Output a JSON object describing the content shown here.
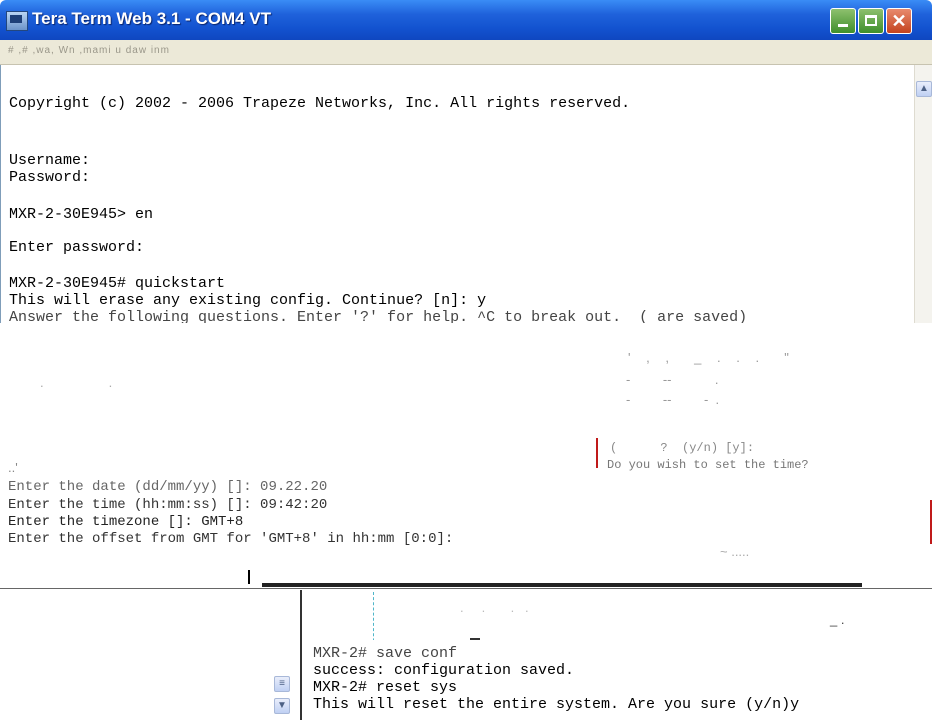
{
  "window": {
    "title": "Tera Term Web 3.1 - COM4 VT",
    "menu_text": "#  ,#  ,wa,  Wn   ,mami u daw inm"
  },
  "terminal": {
    "lines": [
      "Copyright (c) 2002 - 2006 Trapeze Networks, Inc. All rights reserved.",
      "",
      "",
      "Username:",
      "Password:",
      "",
      "MXR-2-30E945> en",
      "",
      "Enter password:",
      "",
      "MXR-2-30E945# quickstart",
      "This will erase any existing config. Continue? [n]: y",
      "Answer the following questions. Enter '?' for help. ^C to break out.  ( are saved)"
    ]
  },
  "middle": {
    "lines": [
      "Enter the date (dd/mm/yy) []: 09.22.20",
      "Enter the time (hh:mm:ss) []: 09:42:20",
      "Enter the timezone []: GMT+8",
      "Enter the offset from GMT for 'GMT+8' in hh:mm [0:0]:"
    ],
    "right_fragment": "Do you wish to set the time?",
    "right_fragment_top": "(      ?  (y/n) [y]:"
  },
  "bottom": {
    "lines": [
      "MXR-2# save conf",
      "success: configuration saved.",
      "MXR-2# reset sys",
      "This will reset the entire system. Are you sure (y/n)y"
    ]
  }
}
